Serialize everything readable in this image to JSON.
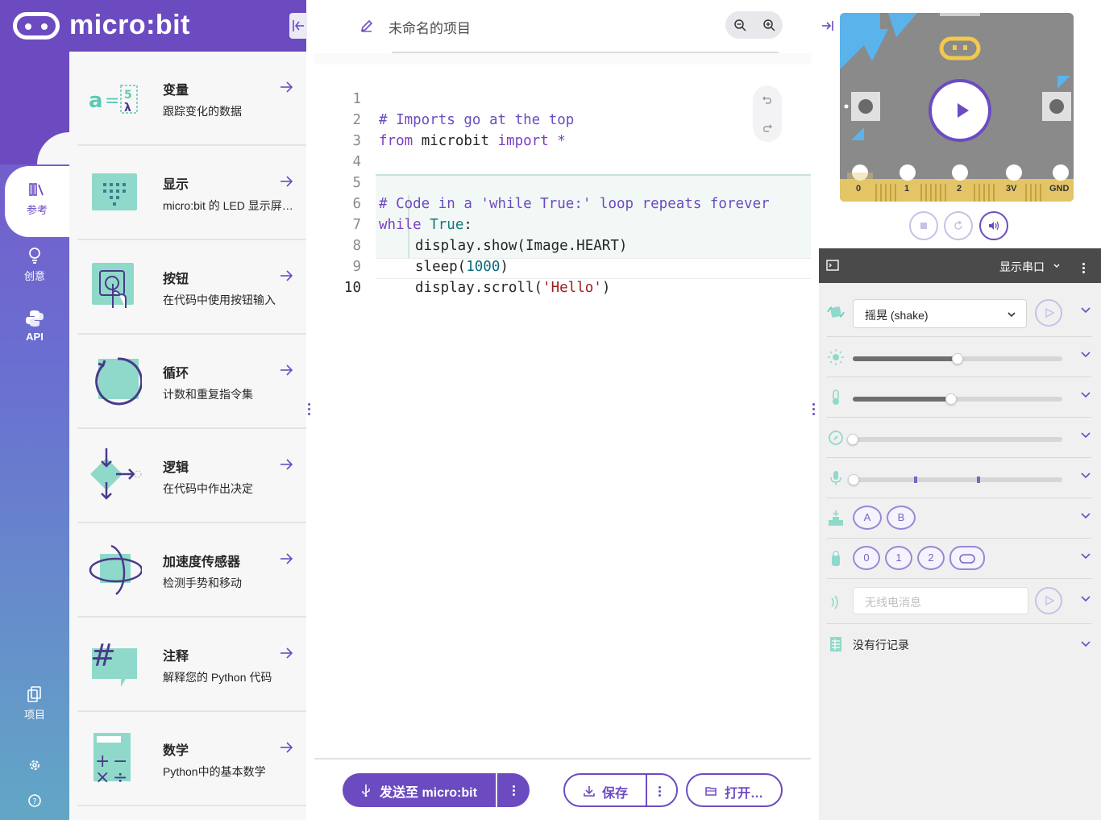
{
  "app": {
    "logo_text": "micro:bit"
  },
  "rail": {
    "items": [
      {
        "label": "参考",
        "icon": "library-icon"
      },
      {
        "label": "创意",
        "icon": "lightbulb-icon"
      },
      {
        "label": "API",
        "icon": "python-icon"
      },
      {
        "label": "项目",
        "icon": "files-icon"
      }
    ],
    "bottom_icons": [
      "settings-icon",
      "help-icon"
    ]
  },
  "reference": {
    "items": [
      {
        "title": "变量",
        "desc": "跟踪变化的数据"
      },
      {
        "title": "显示",
        "desc": "micro:bit 的 LED 显示屏…"
      },
      {
        "title": "按钮",
        "desc": "在代码中使用按钮输入"
      },
      {
        "title": "循环",
        "desc": "计数和重复指令集"
      },
      {
        "title": "逻辑",
        "desc": "在代码中作出决定"
      },
      {
        "title": "加速度传感器",
        "desc": "检测手势和移动"
      },
      {
        "title": "注释",
        "desc": "解释您的 Python 代码"
      },
      {
        "title": "数学",
        "desc": "Python中的基本数学"
      }
    ]
  },
  "editor": {
    "project_name": "未命名的项目",
    "code": {
      "line_numbers": [
        "1",
        "2",
        "3",
        "4",
        "5",
        "6",
        "7",
        "8",
        "9",
        "10"
      ],
      "line1": "# Imports go at the top",
      "line2_kw": "from",
      "line2_mod": " microbit ",
      "line2_kw2": "import",
      "line2_star": " *",
      "line5": "# Code in a 'while True:' loop repeats forever",
      "line6_kw": "while",
      "line6_true": " True",
      "line6_colon": ":",
      "line7": "display.show(Image.HEART)",
      "line8_a": "sleep(",
      "line8_num": "1000",
      "line8_b": ")",
      "line9_a": "display.scroll(",
      "line9_str": "'Hello'",
      "line9_b": ")"
    }
  },
  "footer": {
    "send_label": "发送至 micro:bit",
    "save_label": "保存",
    "open_label": "打开…"
  },
  "simulator": {
    "pins": [
      "0",
      "1",
      "2",
      "3V",
      "GND"
    ],
    "serial_label": "显示串口",
    "gesture_value": "摇晃 (shake)",
    "sliders": {
      "light": 0.5,
      "temperature": 0.47,
      "compass": 0.0
    },
    "sound_marks": [
      0.3,
      0.6
    ],
    "buttons": [
      "A",
      "B"
    ],
    "touch_pins": [
      "0",
      "1",
      "2"
    ],
    "radio_placeholder": "无线电消息",
    "data_log": "没有行记录"
  },
  "colors": {
    "brand": "#6c4bc1",
    "accent_teal": "#5ec8b5"
  }
}
